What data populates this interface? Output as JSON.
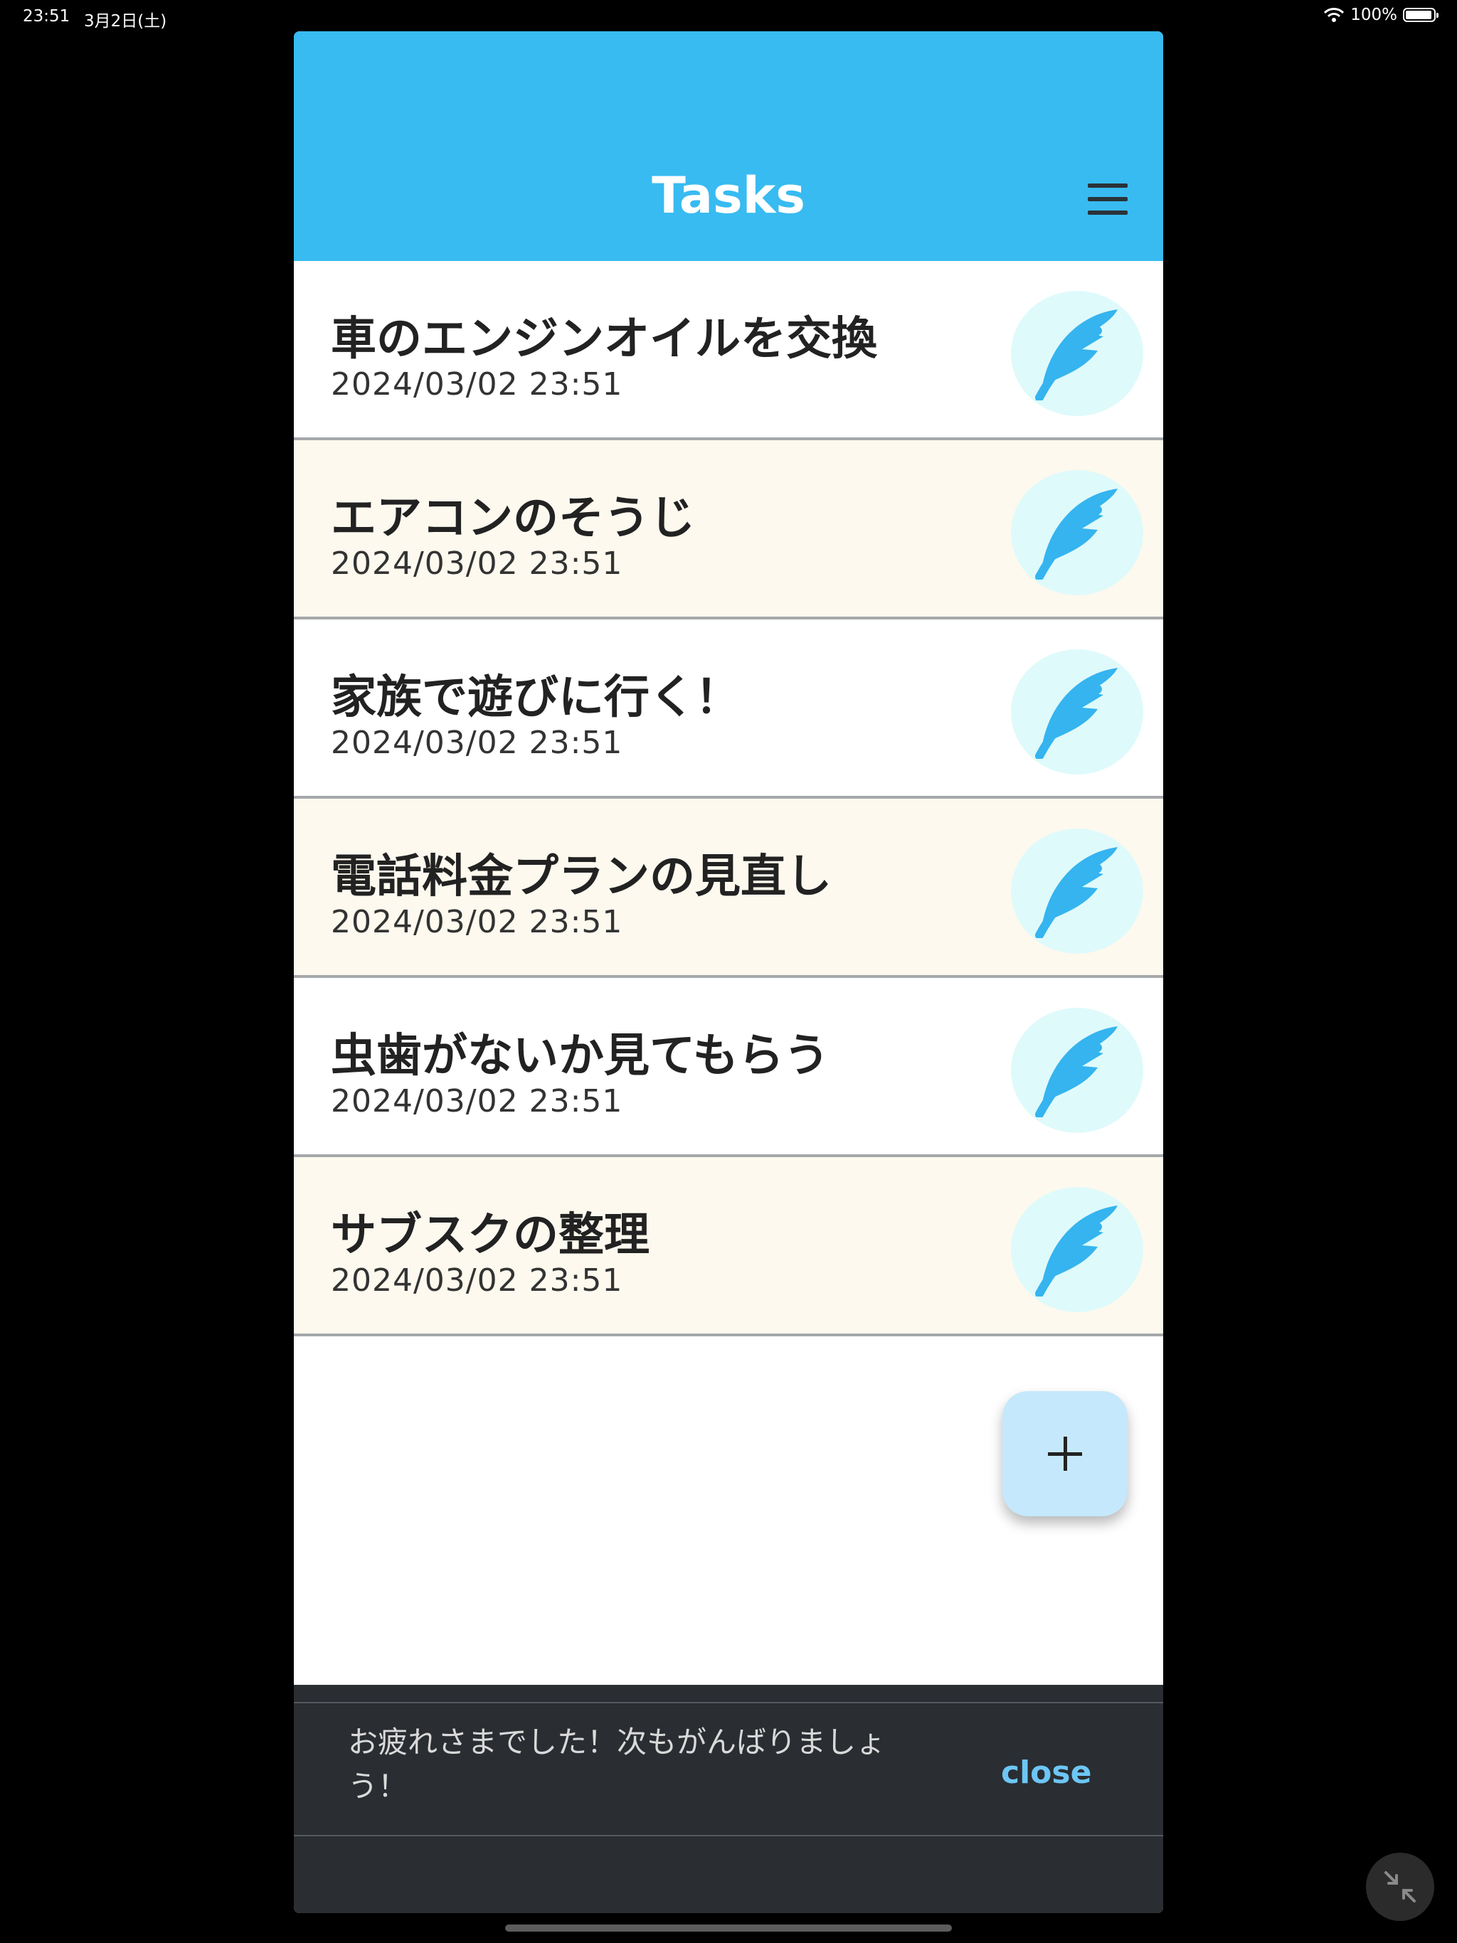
{
  "status_bar": {
    "time": "23:51",
    "date": "3月2日(土)",
    "battery": "100%"
  },
  "app_bar": {
    "title": "Tasks",
    "menu_icon": "hamburger-menu-icon"
  },
  "tasks": [
    {
      "title": "車のエンジンオイルを交換",
      "date": "2024/03/02 23:51"
    },
    {
      "title": "エアコンのそうじ",
      "date": "2024/03/02 23:51"
    },
    {
      "title": "家族で遊びに行く！",
      "date": "2024/03/02 23:51"
    },
    {
      "title": "電話料金プランの見直し",
      "date": "2024/03/02 23:51"
    },
    {
      "title": "虫歯がないか見てもらう",
      "date": "2024/03/02 23:51"
    },
    {
      "title": "サブスクの整理",
      "date": "2024/03/02 23:51"
    }
  ],
  "edit_icon": "feather-edit-icon",
  "fab": {
    "icon": "plus-icon"
  },
  "snackbar": {
    "message": "お疲れさまでした！次もがんばりましょう！",
    "action": "close"
  },
  "colors": {
    "app_bar": "#38bbf1",
    "row_alt": "#fdf9ee",
    "feather": "#35b4ef",
    "edit_circle": "#dffafb",
    "fab": "#c5e8fc",
    "snackbar_bg": "#2a2d31",
    "close_action": "#6dc6f5"
  }
}
